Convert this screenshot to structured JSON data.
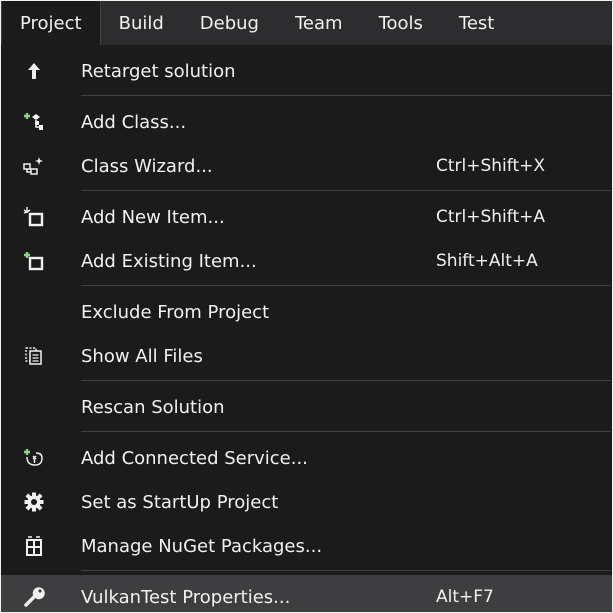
{
  "menubar": {
    "items": [
      {
        "label": "Project",
        "active": true
      },
      {
        "label": "Build",
        "active": false
      },
      {
        "label": "Debug",
        "active": false
      },
      {
        "label": "Team",
        "active": false
      },
      {
        "label": "Tools",
        "active": false
      },
      {
        "label": "Test",
        "active": false
      }
    ]
  },
  "menu": {
    "items": [
      {
        "label": "Retarget solution",
        "shortcut": "",
        "icon": "arrow-up-icon"
      },
      {
        "label": "Add Class...",
        "shortcut": "",
        "icon": "add-class-icon"
      },
      {
        "label": "Class Wizard...",
        "shortcut": "Ctrl+Shift+X",
        "icon": "class-wizard-icon"
      },
      {
        "label": "Add New Item...",
        "shortcut": "Ctrl+Shift+A",
        "icon": "add-new-item-icon"
      },
      {
        "label": "Add Existing Item...",
        "shortcut": "Shift+Alt+A",
        "icon": "add-existing-item-icon"
      },
      {
        "label": "Exclude From Project",
        "shortcut": "",
        "icon": ""
      },
      {
        "label": "Show All Files",
        "shortcut": "",
        "icon": "show-all-files-icon"
      },
      {
        "label": "Rescan Solution",
        "shortcut": "",
        "icon": ""
      },
      {
        "label": "Add Connected Service...",
        "shortcut": "",
        "icon": "connected-service-icon"
      },
      {
        "label": "Set as StartUp Project",
        "shortcut": "",
        "icon": "gear-icon"
      },
      {
        "label": "Manage NuGet Packages...",
        "shortcut": "",
        "icon": "nuget-icon"
      },
      {
        "label": "VulkanTest Properties...",
        "shortcut": "Alt+F7",
        "icon": "wrench-icon",
        "highlighted": true
      }
    ]
  },
  "colors": {
    "menubar_bg": "#2d2d30",
    "menu_bg": "#1b1b1c",
    "highlight_bg": "#3e3e40",
    "text": "#f1f1f1",
    "accent_green": "#8dd28a",
    "separator": "#3f3f46"
  }
}
